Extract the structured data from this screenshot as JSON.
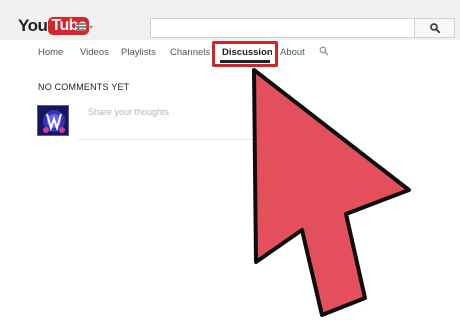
{
  "header": {
    "logo_you": "You",
    "logo_tube": "Tube",
    "guide_icon": "hamburger-menu-icon",
    "search_icon": "search-icon"
  },
  "tabs": [
    {
      "label": "Home"
    },
    {
      "label": "Videos"
    },
    {
      "label": "Playlists"
    },
    {
      "label": "Channels"
    },
    {
      "label": "Discussion",
      "active": true
    },
    {
      "label": "About"
    }
  ],
  "tab_search_icon": "magnifier-icon",
  "comments": {
    "heading": "NO COMMENTS YET",
    "placeholder": "Share your thoughts"
  },
  "colors": {
    "highlight": "#d2242b",
    "pointer_fill": "#e3505c",
    "logo_red": "#d6262a"
  }
}
